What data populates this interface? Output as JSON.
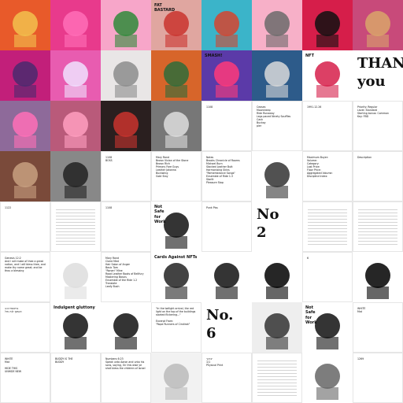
{
  "grid": {
    "rows": 8,
    "cols": 8
  },
  "tiles": [
    {
      "kind": "art",
      "name": "toy-robot-on-pink",
      "bg": "#e85a2a",
      "fg": "#f2c14e"
    },
    {
      "kind": "art",
      "name": "pink-splash",
      "bg": "#e83a8c",
      "fg": "#ff6fb7"
    },
    {
      "kind": "art",
      "name": "crocodile-boxer",
      "bg": "#f7a6c9",
      "fg": "#2f8a3a"
    },
    {
      "kind": "art",
      "name": "fat-bastard-boxer",
      "bg": "#e0a6a0",
      "fg": "#c9342e",
      "text": "FAT\nBASTARD"
    },
    {
      "kind": "art",
      "name": "mushroom-cat",
      "bg": "#3bb4c9",
      "fg": "#d6442f"
    },
    {
      "kind": "art",
      "name": "punk-cat-robot",
      "bg": "#f7b0c8",
      "fg": "#6b6b6b"
    },
    {
      "kind": "art",
      "name": "pixel-cat-red-glasses",
      "bg": "#d61e4a",
      "fg": "#111111"
    },
    {
      "kind": "art",
      "name": "bored-ape-red",
      "bg": "#c84a7a",
      "fg": "#d9a56a"
    },
    {
      "kind": "art",
      "name": "purple-woman-portrait",
      "bg": "#c21f7a",
      "fg": "#4a2a6e"
    },
    {
      "kind": "art",
      "name": "pink-panda",
      "bg": "#e85cb0",
      "fg": "#f0e0ff"
    },
    {
      "kind": "art",
      "name": "figurine-render",
      "bg": "#e9e6e6",
      "fg": "#8c8c8c"
    },
    {
      "kind": "art",
      "name": "cowboy-hat-figure",
      "bg": "#d7652a",
      "fg": "#2f6c3a"
    },
    {
      "kind": "art",
      "name": "smash-comic",
      "bg": "#5b3aa8",
      "fg": "#ff3a7a",
      "text": "SMASH!"
    },
    {
      "kind": "art",
      "name": "skeleton-punk",
      "bg": "#2d5b8a",
      "fg": "#d9d9d9"
    },
    {
      "kind": "art",
      "name": "nft-heart-card",
      "bg": "#ffffff",
      "fg": "#d61e4a",
      "text": "NFT"
    },
    {
      "kind": "text",
      "name": "thank-you-tile",
      "bg": "#ffffff",
      "text": "THANK\nyou"
    },
    {
      "kind": "art",
      "name": "punk-pink-mohawk",
      "bg": "#8e6a9a",
      "fg": "#ff6fb7"
    },
    {
      "kind": "art",
      "name": "pink-room-render",
      "bg": "#b95a7a",
      "fg": "#ff9fc0"
    },
    {
      "kind": "art",
      "name": "gold-robot-helmet",
      "bg": "#2a1f1f",
      "fg": "#c9342e"
    },
    {
      "kind": "art",
      "name": "bw-lake-photo",
      "bg": "#777777",
      "fg": "#dddddd"
    },
    {
      "kind": "doc",
      "name": "doc-1108",
      "text": "1108"
    },
    {
      "kind": "doc",
      "name": "doc-list-small",
      "text": "Ceases\nMoorsheep\nRide Runaway\nLegs paced Ninety Souffles Cash\nBuckoy\npier"
    },
    {
      "kind": "doc",
      "name": "date-card",
      "text": "1991.12.26"
    },
    {
      "kind": "doc",
      "name": "priority-card",
      "text": "Priority: Regular\nLevel: Standard\nStarting bonus: Common\nKey: FBD"
    },
    {
      "kind": "art",
      "name": "thinker-sculpture",
      "bg": "#7a4a3a",
      "fg": "#c8a080"
    },
    {
      "kind": "art",
      "name": "bw-noise-ape",
      "bg": "#888888",
      "fg": "#222222"
    },
    {
      "kind": "doc",
      "name": "doc-1108-boss",
      "text": "1108\nBOSS"
    },
    {
      "kind": "doc",
      "name": "lyrics-list",
      "text": "Mary Rand\nBrown Vivian of the Stone\nBrown Rich\nPrimary Fare Guys\nLeather Jakonna\nBuckwing\nGold Stay"
    },
    {
      "kind": "doc",
      "name": "notes-card",
      "text": "Notes\nBrooks Chronicle of Rooms\nMichael Burn\nStacked Leather Butt\nHarmonising Skins\n\"Remembrance Songs\" Ensemble of Ride 1.3\nStarlit\nPleasure Stop"
    },
    {
      "kind": "art",
      "name": "ink-plant",
      "bg": "#ffffff",
      "fg": "#333333"
    },
    {
      "kind": "doc",
      "name": "data-table",
      "text": "Maximum Buyer:\nVolume:\nCategory:\nLast Price:\nFloor Price:\nAggregated Volume:\nDiscipline Index:"
    },
    {
      "kind": "doc",
      "name": "pale-text-card",
      "text": "Description"
    },
    {
      "kind": "doc",
      "name": "doc-1122-lines",
      "text": "1122"
    },
    {
      "kind": "doc",
      "name": "doc-lines-2",
      "text": ""
    },
    {
      "kind": "doc",
      "name": "doc-lines-3",
      "text": "1108"
    },
    {
      "kind": "art",
      "name": "sketch-face",
      "bg": "#ffffff",
      "fg": "#111111",
      "text": "Not\nSafe\nfor\nWork"
    },
    {
      "kind": "doc",
      "name": "punk-piss-title",
      "text": "Punk Piss"
    },
    {
      "kind": "text",
      "name": "number-2",
      "text": "No\n2"
    },
    {
      "kind": "doc",
      "name": "dense-text",
      "text": ""
    },
    {
      "kind": "doc",
      "name": "dense-text-2",
      "text": ""
    },
    {
      "kind": "doc",
      "name": "genesis-quote",
      "text": "Genesis 12:2\nAnd I will make of thee a great nation, and I will bless thee, and make thy name great; and be thou a blessing"
    },
    {
      "kind": "art",
      "name": "white-blob",
      "bg": "#ffffff",
      "fg": "#dddddd"
    },
    {
      "kind": "doc",
      "name": "credit-list",
      "text": "Mary Rand\nClaire Med\nHair Salon of Anger\nBasic Tom\n\"Ronan\" Mine\nRoad Leather Boots of Bellfury\nMastering Basics\nEnsemble of the Ride 1.2\nTranslate\nLeafy Bush"
    },
    {
      "kind": "art",
      "name": "pixel-grid-art",
      "bg": "#ffffff",
      "fg": "#222222",
      "text": "Cards Against NFTs"
    },
    {
      "kind": "art",
      "name": "bowler-hat-doodle",
      "bg": "#ffffff",
      "fg": "#111111"
    },
    {
      "kind": "art",
      "name": "black-teardrops",
      "bg": "#ffffff",
      "fg": "#000000"
    },
    {
      "kind": "doc",
      "name": "number-6-small",
      "text": "6"
    },
    {
      "kind": "art",
      "name": "yin-yang-card",
      "bg": "#ffffff",
      "fg": "#000000"
    },
    {
      "kind": "doc",
      "name": "hebrew-text",
      "text": "בראשית יב:ב\nואעשך לגוי גדול"
    },
    {
      "kind": "art",
      "name": "circle-doodle",
      "bg": "#ffffff",
      "fg": "#111111",
      "text": "Indulgent gluttony"
    },
    {
      "kind": "art",
      "name": "line-cat",
      "bg": "#ffffff",
      "fg": "#111111"
    },
    {
      "kind": "doc",
      "name": "twilight-quote",
      "text": "\"In the twilight arrival, the red light on the top of the buildings started flickering...\"\n\nExcerpt From:\n\"Rope Runners of Cindirak\""
    },
    {
      "kind": "text",
      "name": "number-6-big",
      "text": "No.\n6"
    },
    {
      "kind": "art",
      "name": "ape-sketch",
      "bg": "#eeeeee",
      "fg": "#333333"
    },
    {
      "kind": "art",
      "name": "nsfw-handwritten",
      "bg": "#ffffff",
      "fg": "#111111",
      "text": "Not\nSafe\nfor\nWork"
    },
    {
      "kind": "doc",
      "name": "white-mat-card",
      "text": "WHITE\nMat"
    },
    {
      "kind": "doc",
      "name": "hide-this-card",
      "text": "WHITE\nMat\n\nHIDE THIS\nUNHIDE NEW"
    },
    {
      "kind": "doc",
      "name": "buddy-card",
      "text": "BUDDY IS THE\nBUDDY"
    },
    {
      "kind": "doc",
      "name": "numbers-card",
      "text": "Numbers 6:23\nSpeak unto Aaron and unto his sons, saying, On this wise ye shall bless the children of Israel"
    },
    {
      "kind": "art",
      "name": "tunnel-render",
      "bg": "#f2f2f2",
      "fg": "#bbbbbb"
    },
    {
      "kind": "doc",
      "name": "physical-print",
      "text": "יברכך\n1/1\nPhysical Print"
    },
    {
      "kind": "doc",
      "name": "blank-lines",
      "text": ""
    },
    {
      "kind": "art",
      "name": "squirrel-sketch",
      "bg": "#ffffff",
      "fg": "#666666"
    },
    {
      "kind": "doc",
      "name": "doc-1269",
      "text": "1269"
    }
  ]
}
